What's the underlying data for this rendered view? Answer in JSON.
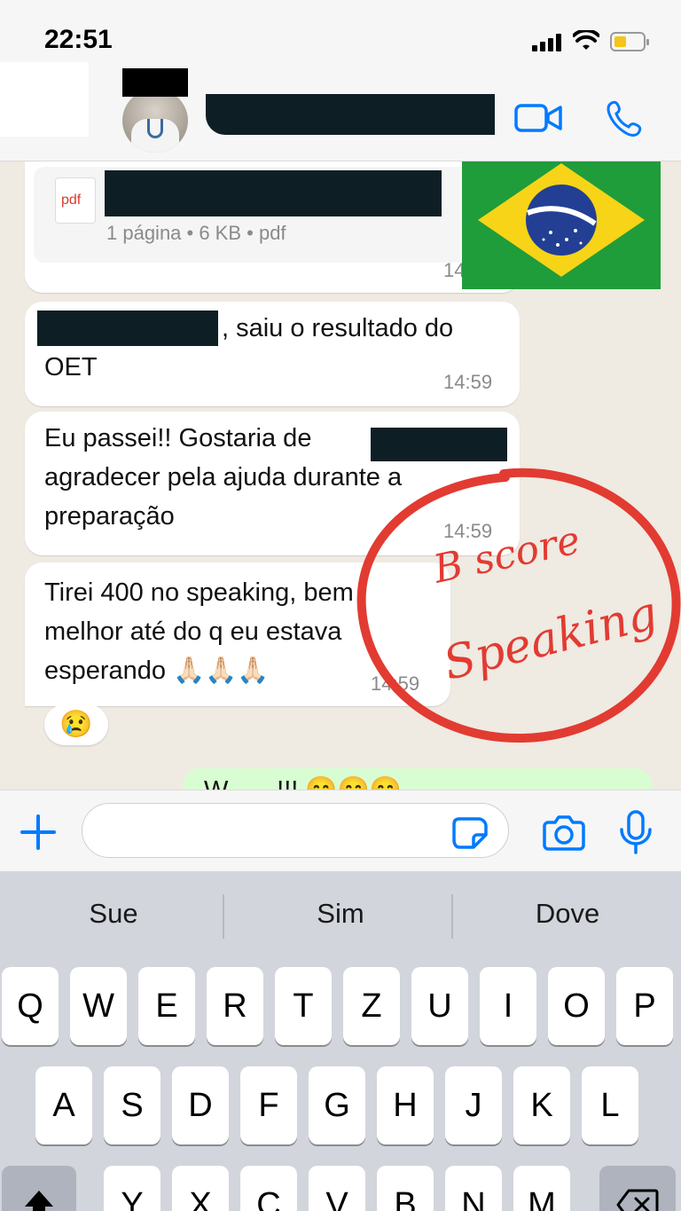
{
  "status_bar": {
    "time": "22:51"
  },
  "header": {
    "video_icon": "video-camera-icon",
    "phone_icon": "phone-icon"
  },
  "messages": [
    {
      "type": "document",
      "doc_type": "pdf",
      "meta": "1 página • 6 KB • pdf",
      "time": "14"
    },
    {
      "type": "text",
      "text": ", saiu o resultado do OET",
      "time": "14:59"
    },
    {
      "type": "text",
      "text_line1": "Eu passei!! Gostaria de",
      "text_line2": "agradecer pela ajuda durante a",
      "text_line3": "preparação",
      "time": "14:59"
    },
    {
      "type": "text",
      "text_line1": "Tirei 400 no speaking, bem",
      "text_line2": "melhor até do q eu estava",
      "text_line3": "esperando 🙏🏻🙏🏻🙏🏻",
      "time": "14:59",
      "reaction": "😢"
    }
  ],
  "outgoing_partial": "W... ...!!! 😊😊😊",
  "annotation": {
    "line1": "B score",
    "line2": "Speaking",
    "color": "#e23b32"
  },
  "input": {
    "placeholder": ""
  },
  "keyboard": {
    "suggestions": [
      "Sue",
      "Sim",
      "Dove"
    ],
    "row1": [
      "Q",
      "W",
      "E",
      "R",
      "T",
      "Z",
      "U",
      "I",
      "O",
      "P"
    ],
    "row2": [
      "A",
      "S",
      "D",
      "F",
      "G",
      "H",
      "J",
      "K",
      "L"
    ],
    "row3": [
      "Y",
      "X",
      "C",
      "V",
      "B",
      "N",
      "M"
    ]
  },
  "colors": {
    "accent": "#007aff",
    "chat_bg": "#efeae2",
    "bubble_in": "#ffffff",
    "bubble_out": "#d9fdd3"
  }
}
